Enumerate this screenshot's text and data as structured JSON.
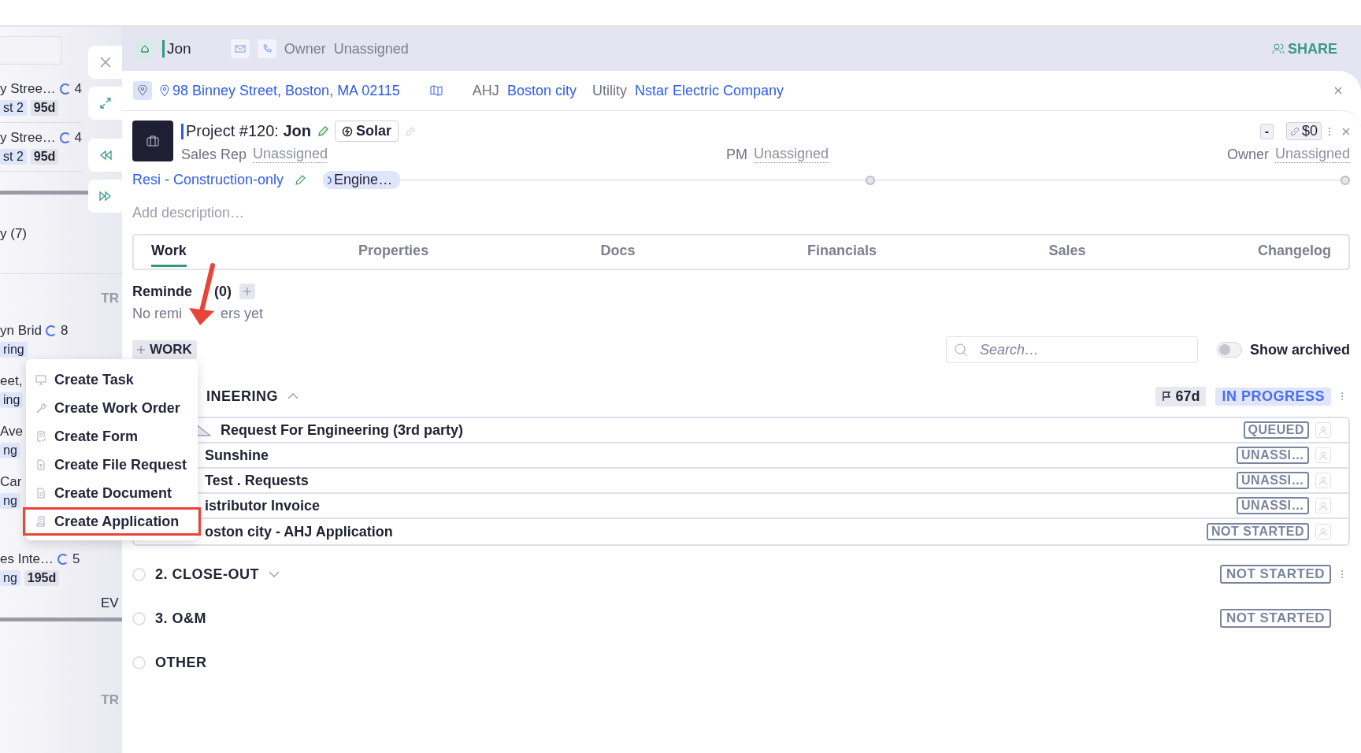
{
  "background_list": {
    "cards_top": [
      {
        "line1": "y Stree…",
        "count": "4",
        "line2": "st 2",
        "age": "95d"
      },
      {
        "line1": "y Stree…",
        "count": "4",
        "line2": "st 2",
        "age": "95d"
      }
    ],
    "group_label": "y (7)",
    "column_head": "TR",
    "cards_bottom": [
      {
        "line1": "yn Brid",
        "count": "8",
        "line2": "ring"
      },
      {
        "line1": "eet,",
        "line2": "ing"
      },
      {
        "line1": "Ave",
        "line2": "ng"
      },
      {
        "line1": "Car",
        "line2": "ng"
      },
      {
        "line1": "es Inte…",
        "count": "5",
        "line2": "ng",
        "age": "195d",
        "extra": "EV"
      }
    ],
    "column_head_2": "TR"
  },
  "header": {
    "name": "Jon",
    "owner_label": "Owner",
    "owner": "Unassigned",
    "share": "SHARE"
  },
  "location": {
    "address": "98 Binney Street, Boston, MA 02115",
    "ahj_label": "AHJ",
    "ahj": "Boston city",
    "utility_label": "Utility",
    "utility": "Nstar Electric Company"
  },
  "project": {
    "title_prefix": "Project #120:",
    "name": "Jon",
    "type": "Solar",
    "minus": "-",
    "value": "$0",
    "sales_rep_label": "Sales Rep",
    "sales_rep": "Unassigned",
    "pm_label": "PM",
    "pm": "Unassigned",
    "owner_label": "Owner",
    "owner": "Unassigned",
    "workflow": "Resi - Construction-only",
    "stage": "Engine…",
    "description_placeholder": "Add description…"
  },
  "tabs": [
    {
      "label": "Work",
      "selected": true
    },
    {
      "label": "Properties",
      "selected": false
    },
    {
      "label": "Docs",
      "selected": false
    },
    {
      "label": "Financials",
      "selected": false
    },
    {
      "label": "Sales",
      "selected": false
    },
    {
      "label": "Changelog",
      "selected": false
    }
  ],
  "reminders": {
    "title_start": "Reminde",
    "count": "(0)",
    "empty_start": "No remi",
    "empty_end": "ers yet"
  },
  "work_button": "WORK",
  "search": {
    "placeholder": "Search…"
  },
  "show_archived": {
    "label": "Show archived",
    "on": false
  },
  "sections": [
    {
      "title": "INEERING",
      "expanded": true,
      "age": "67d",
      "status": "IN PROGRESS",
      "kind": "current",
      "menu": true,
      "items": [
        {
          "title": "Request For Engineering (3rd party)",
          "status": "QUEUED"
        },
        {
          "title": "Sunshine",
          "status": "UNASSI…"
        },
        {
          "title": "Test . Requests",
          "status": "UNASSI…"
        },
        {
          "title": "istributor Invoice",
          "status": "UNASSI…"
        },
        {
          "title": "oston city - AHJ Application",
          "status": "NOT STARTED"
        }
      ]
    },
    {
      "title": "2. CLOSE-OUT",
      "expanded": false,
      "status": "NOT STARTED",
      "kind": "pending",
      "menu": true
    },
    {
      "title": "3. O&M",
      "status": "NOT STARTED",
      "kind": "pending",
      "menu": false
    },
    {
      "title": "OTHER",
      "menu": false
    }
  ],
  "menu": {
    "items": [
      {
        "label": "Create Task",
        "highlighted": false
      },
      {
        "label": "Create Work Order",
        "highlighted": false
      },
      {
        "label": "Create Form",
        "highlighted": false
      },
      {
        "label": "Create File Request",
        "highlighted": false
      },
      {
        "label": "Create Document",
        "highlighted": false
      },
      {
        "label": "Create Application",
        "highlighted": true
      }
    ]
  }
}
